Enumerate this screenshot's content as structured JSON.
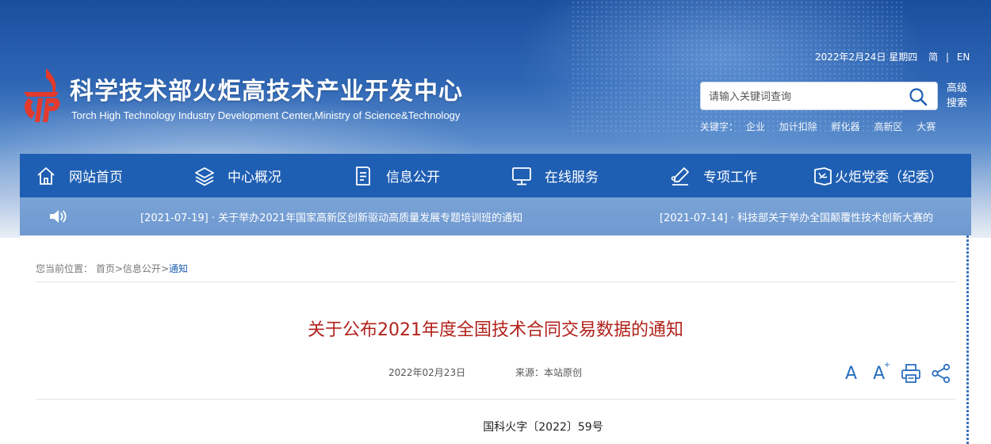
{
  "header": {
    "site_title": "科学技术部火炬高技术产业开发中心",
    "site_subtitle": "Torch High Technology Industry Development Center,Ministry of Science&Technology",
    "date": "2022年2月24日 星期四",
    "lang_simplified": "简",
    "lang_separator": "|",
    "lang_english": "EN",
    "brand_color": "#1f5fb3",
    "logo_color": "#e23a2c"
  },
  "search": {
    "placeholder": "请输入关键词查询",
    "advanced_label": "高级搜索",
    "keywords_label": "关键字：",
    "keywords": [
      "企业",
      "加计扣除",
      "孵化器",
      "高新区",
      "大赛"
    ]
  },
  "nav": {
    "items": [
      {
        "label": "网站首页",
        "icon": "home-icon"
      },
      {
        "label": "中心概况",
        "icon": "layers-icon"
      },
      {
        "label": "信息公开",
        "icon": "document-icon"
      },
      {
        "label": "在线服务",
        "icon": "monitor-icon"
      },
      {
        "label": "专项工作",
        "icon": "pen-icon"
      },
      {
        "label": "火炬党委（纪委）",
        "icon": "party-icon"
      }
    ]
  },
  "ticker": {
    "icon": "speaker-icon",
    "items": [
      "[2021-07-19] · 关于举办2021年国家高新区创新驱动高质量发展专题培训班的通知",
      "[2021-07-14] · 科技部关于举办全国颠覆性技术创新大赛的"
    ]
  },
  "breadcrumb": {
    "label": "您当前位置：",
    "home": "首页",
    "sep1": ">",
    "section": "信息公开",
    "sep2": ">",
    "current": "通知"
  },
  "article": {
    "title": "关于公布2021年度全国技术合同交易数据的通知",
    "date": "2022年02月23日",
    "source": "来源：本站原创",
    "font_small": "A",
    "font_large": "A",
    "font_plus": "+",
    "doc_number": "国科火字〔2022〕59号",
    "title_color": "#b1221b"
  }
}
